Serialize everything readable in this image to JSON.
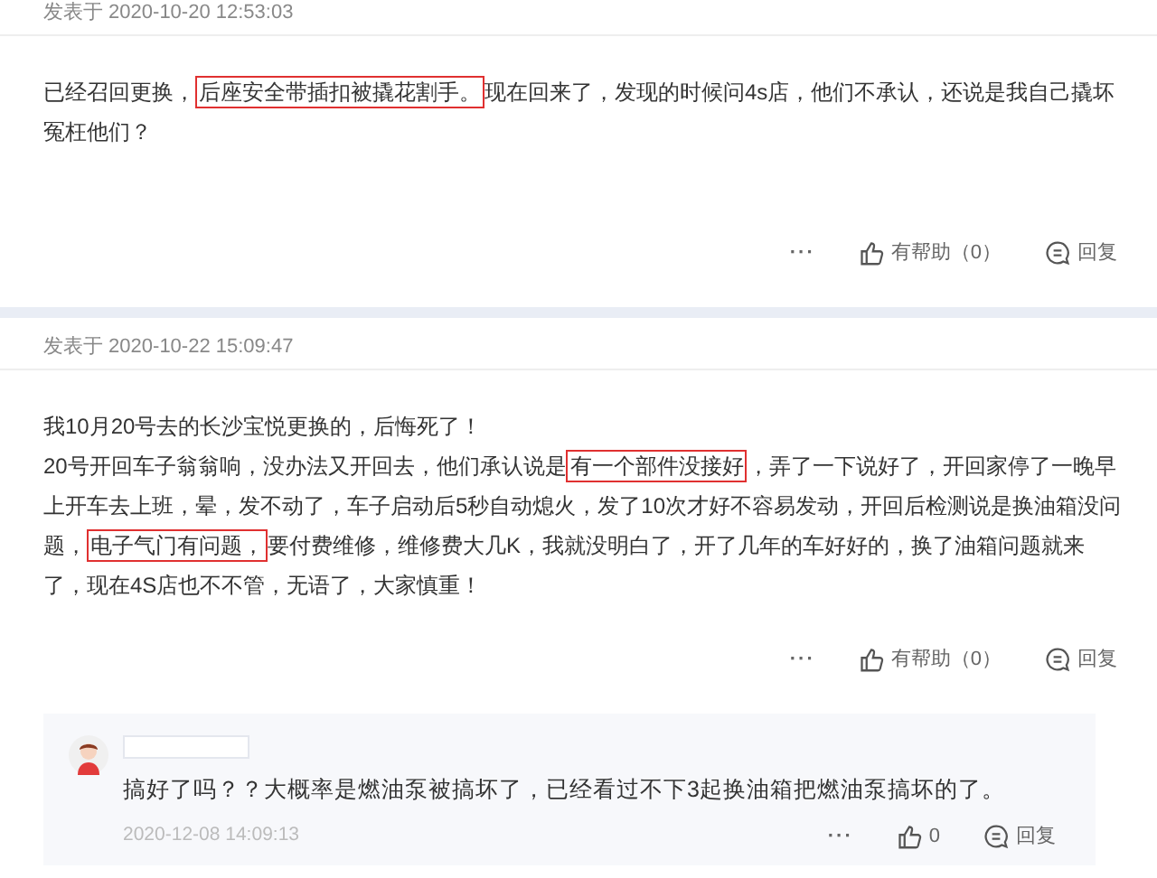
{
  "posts": [
    {
      "posted": "发表于 2020-10-20 12:53:03",
      "paragraphs": [
        [
          {
            "text": "已经召回更换，",
            "highlighted": false
          },
          {
            "text": "后座安全带插扣被撬花割手。",
            "highlighted": true
          },
          {
            "text": "现在回来了，发现的时候问4s店，他们不承认，还说是我自己撬坏冤枉他们？",
            "highlighted": false
          }
        ]
      ],
      "more": "···",
      "helpful": "有帮助（0）",
      "reply": "回复"
    },
    {
      "posted": "发表于 2020-10-22 15:09:47",
      "paragraphs": [
        [
          {
            "text": "我10月20号去的长沙宝悦更换的，后悔死了！",
            "highlighted": false
          }
        ],
        [
          {
            "text": "20号开回车子翁翁响，没办法又开回去，他们承认说是",
            "highlighted": false
          },
          {
            "text": "有一个部件没接好",
            "highlighted": true
          },
          {
            "text": "，弄了一下说好了，开回家停了一晚早上开车去上班，晕，发不动了，车子启动后5秒自动熄火，发了10次才好不容易发动，开回后检测说是换油箱没问题，",
            "highlighted": false
          },
          {
            "text": "电子气门有问题，",
            "highlighted": true
          },
          {
            "text": "要付费维修，维修费大几K，我就没明白了，开了几年的车好好的，换了油箱问题就来了，现在4S店也不不管，无语了，大家慎重！",
            "highlighted": false
          }
        ]
      ],
      "more": "···",
      "helpful": "有帮助（0）",
      "reply": "回复",
      "replies": [
        {
          "text": "搞好了吗？？大概率是燃油泵被搞坏了，已经看过不下3起换油箱把燃油泵搞坏的了。",
          "time": "2020-12-08 14:09:13",
          "more": "···",
          "likes": "0",
          "reply": "回复"
        }
      ]
    }
  ]
}
